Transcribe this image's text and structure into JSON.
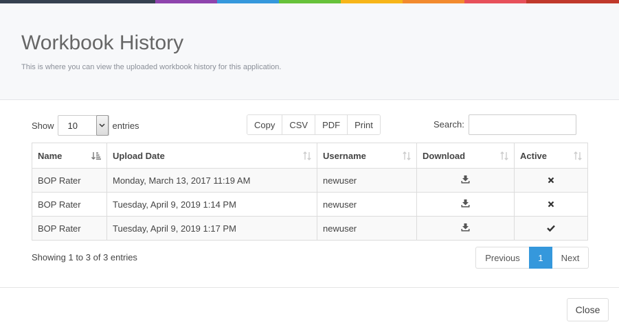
{
  "colors": {
    "bar": [
      "#364150",
      "#8e44ad",
      "#3598dc",
      "#67c23a",
      "#f7b518",
      "#f28a2e",
      "#e7505a",
      "#c0392b"
    ],
    "accent": "#3598dc"
  },
  "header": {
    "title": "Workbook History",
    "subtitle": "This is where you can view the uploaded workbook history for this application."
  },
  "length": {
    "show_label": "Show",
    "value": "10",
    "entries_label": "entries"
  },
  "export_buttons": [
    "Copy",
    "CSV",
    "PDF",
    "Print"
  ],
  "search": {
    "label": "Search:",
    "value": ""
  },
  "table": {
    "columns": [
      "Name",
      "Upload Date",
      "Username",
      "Download",
      "Active"
    ],
    "sorted_column": "Name",
    "rows": [
      {
        "name": "BOP Rater",
        "upload_date": "Monday, March 13, 2017 11:19 AM",
        "username": "newuser",
        "download_icon": "download-icon",
        "active_icon": "times-icon"
      },
      {
        "name": "BOP Rater",
        "upload_date": "Tuesday, April 9, 2019 1:14 PM",
        "username": "newuser",
        "download_icon": "download-icon",
        "active_icon": "times-icon"
      },
      {
        "name": "BOP Rater",
        "upload_date": "Tuesday, April 9, 2019 1:17 PM",
        "username": "newuser",
        "download_icon": "download-icon",
        "active_icon": "check-icon"
      }
    ]
  },
  "info": "Showing 1 to 3 of 3 entries",
  "pagination": {
    "previous": "Previous",
    "current": "1",
    "next": "Next"
  },
  "footer": {
    "close_label": "Close"
  }
}
